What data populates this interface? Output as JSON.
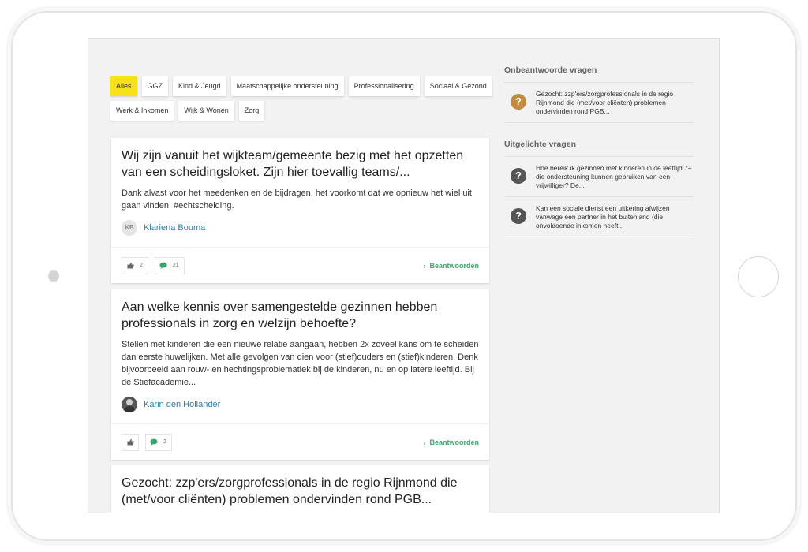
{
  "filters": {
    "row1": [
      "Alles",
      "GGZ",
      "Kind & Jeugd",
      "Maatschappelijke ondersteuning",
      "Professionalisering",
      "Sociaal & Gezond"
    ],
    "row2": [
      "Werk & Inkomen",
      "Wijk & Wonen",
      "Zorg"
    ],
    "active": "Alles",
    "active_color": "#f7e118"
  },
  "questions": [
    {
      "title": "Wij zijn vanuit het wijkteam/gemeente bezig met het opzetten van een scheidingsloket. Zijn hier toevallig teams/...",
      "excerpt": "Dank alvast voor het meedenken en de bijdragen, het voorkomt dat we opnieuw het wiel uit gaan vinden! #echtscheiding.",
      "author": {
        "initials": "KB",
        "name": "Klariena Bouma"
      },
      "likes": "2",
      "comments": "21",
      "answer_label": "Beantwoorden"
    },
    {
      "title": "Aan welke kennis over samengestelde gezinnen hebben professionals in zorg en welzijn behoefte?",
      "excerpt": "Stellen met kinderen die een nieuwe relatie aangaan, hebben 2x zoveel kans om te scheiden dan eerste huwelijken. Met alle gevolgen van dien voor (stief)ouders en (stief)kinderen. Denk bijvoorbeeld aan rouw- en hechtingsproblematiek bij de kinderen, nu en op latere leeftijd. Bij de Stiefacademie...",
      "author": {
        "initials": "",
        "name": "Karin den Hollander"
      },
      "likes": "",
      "comments": "2",
      "answer_label": "Beantwoorden"
    },
    {
      "title": "Gezocht: zzp'ers/zorgprofessionals in de regio Rijnmond die (met/voor cliënten) problemen ondervinden rond PGB..."
    }
  ],
  "sidebar": {
    "unanswered_heading": "Onbeantwoorde vragen",
    "unanswered": [
      {
        "text": "Gezocht: zzp'ers/zorgprofessionals in de regio Rijnmond die (met/voor cliënten) problemen ondervinden rond PGB..."
      }
    ],
    "featured_heading": "Uitgelichte vragen",
    "featured": [
      {
        "text": "Hoe bereik ik gezinnen met kinderen in de leeftijd 7+ die ondersteuning kunnen gebruiken van een vrijwilliger? De..."
      },
      {
        "text": "Kan een sociale dienst een uitkering afwijzen vanwege een partner in het buitenland (die onvoldoende inkomen heeft..."
      }
    ]
  },
  "icons": {
    "like": "thumbs-up-icon",
    "comment": "speech-bubble-icon",
    "question": "question-mark-icon",
    "answer_chevron": "chevron-right-icon"
  },
  "colors": {
    "link_blue": "#2f7da8",
    "answer_green": "#3aa56a",
    "unanswered_icon": "#c48a3e",
    "featured_icon": "#555555"
  }
}
